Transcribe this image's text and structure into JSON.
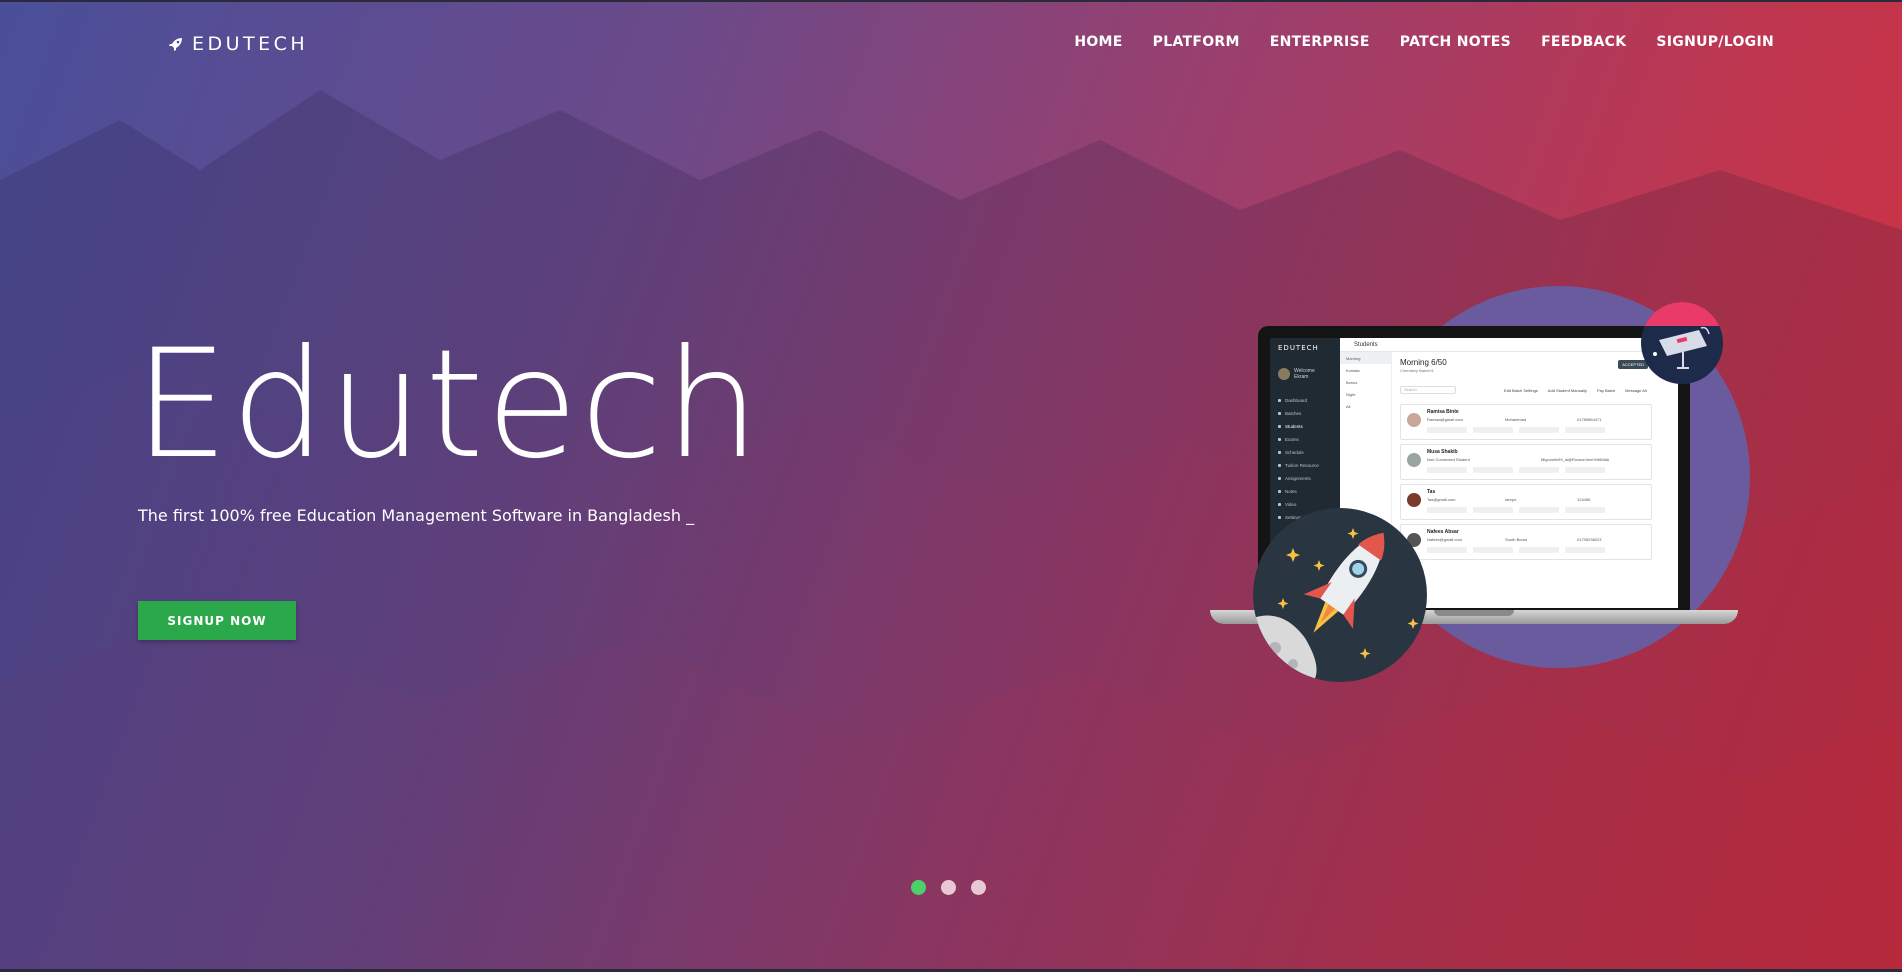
{
  "header": {
    "brand": "EDUTECH",
    "nav": [
      "HOME",
      "PLATFORM",
      "ENTERPRISE",
      "PATCH NOTES",
      "FEEDBACK",
      "SIGNUP/LOGIN"
    ]
  },
  "hero": {
    "title": "Edutech",
    "subtitle": "The first 100% free Education Management Software in Bangladesh _",
    "cta_label": "SIGNUP NOW"
  },
  "mockup": {
    "brand": "EDUTECH",
    "user_greeting": "Welcome",
    "user_name": "Ekram",
    "page_label": "Students",
    "sidebar_items": [
      "Dashboard",
      "Batches",
      "Students",
      "Exams",
      "Schedule",
      "Tuition Resource",
      "Assignments",
      "Notes",
      "Video",
      "Settings"
    ],
    "sublist": [
      "Morning",
      "Kuntala",
      "Bonus",
      "Night",
      "All"
    ],
    "main_title": "Morning 6/50",
    "main_sub": "Chemistry Batch01",
    "accepted_label": "ACCEPTED",
    "search_placeholder": "Search",
    "actions": [
      "Edit Batch Settings",
      "Add Student Manually",
      "Pay Batch",
      "Message All"
    ],
    "students": [
      {
        "name": "Ramisa Binte",
        "email": "Ramisa@gmail.com",
        "field2": "Mohammad",
        "field3": "01789564471"
      },
      {
        "name": "Musa Shakib",
        "email": "Non Connected Student",
        "field2": "Mignonlin99_la@Rockon3em%56Ma6",
        "field3": ""
      },
      {
        "name": "Tas",
        "email": "Tas@gmail.com",
        "field2": "Iarepo",
        "field3": "124456"
      },
      {
        "name": "Nafees Absar",
        "email": "Nafees@gmail.com",
        "field2": "South Bonia",
        "field3": "01795236023"
      }
    ]
  },
  "slider": {
    "count": 3,
    "active_index": 0
  },
  "colors": {
    "cta": "#2aa84a",
    "dot_active": "#4cd06a",
    "dot_inactive": "#e8c8d4",
    "gradient_left": "#4a4f9a",
    "gradient_right": "#d3303f"
  }
}
